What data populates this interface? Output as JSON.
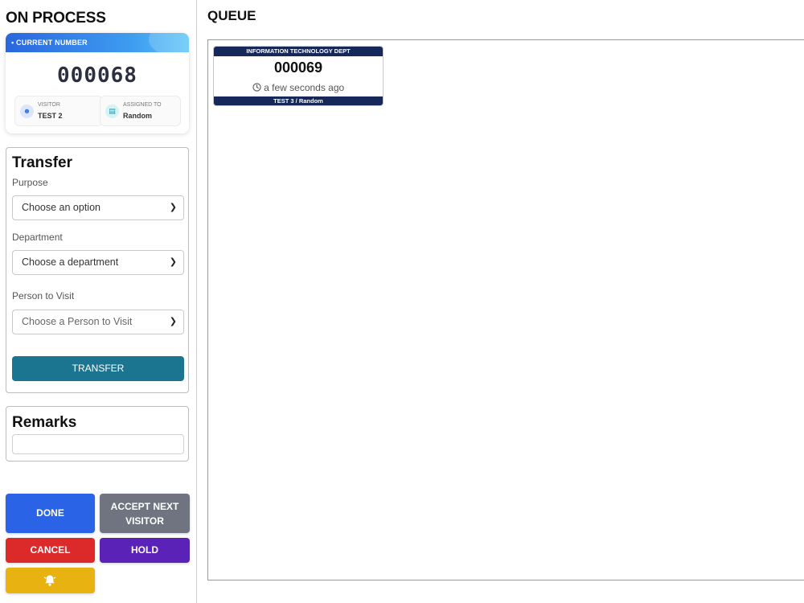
{
  "on_process": {
    "title": "ON PROCESS",
    "current": {
      "header_label": "• CURRENT NUMBER",
      "number": "000068",
      "visitor_label": "VISITOR",
      "visitor_value": "TEST 2",
      "assigned_label": "ASSIGNED TO",
      "assigned_value": "Random"
    }
  },
  "transfer": {
    "title": "Transfer",
    "purpose_label": "Purpose",
    "purpose_value": "Choose an option",
    "department_label": "Department",
    "department_value": "Choose a department",
    "person_label": "Person to Visit",
    "person_value": "Choose a Person to Visit",
    "button_label": "TRANSFER"
  },
  "remarks": {
    "title": "Remarks",
    "value": ""
  },
  "actions": {
    "done": "DONE",
    "accept_line1": "ACCEPT NEXT",
    "accept_line2": "VISITOR",
    "cancel": "CANCEL",
    "hold": "HOLD",
    "bell_icon": "bell-icon"
  },
  "queue": {
    "title": "QUEUE",
    "items": [
      {
        "department": "INFORMATION TECHNOLOGY DEPT",
        "number": "000069",
        "time": "a few seconds ago",
        "footer": "TEST 3 / Random"
      }
    ]
  },
  "colors": {
    "done": "#2b63e6",
    "accept": "#6f7480",
    "cancel": "#dc2a2a",
    "hold": "#5b22b8",
    "bell": "#e8b310",
    "transfer": "#1b7590",
    "queue_card_band": "#16275a"
  }
}
